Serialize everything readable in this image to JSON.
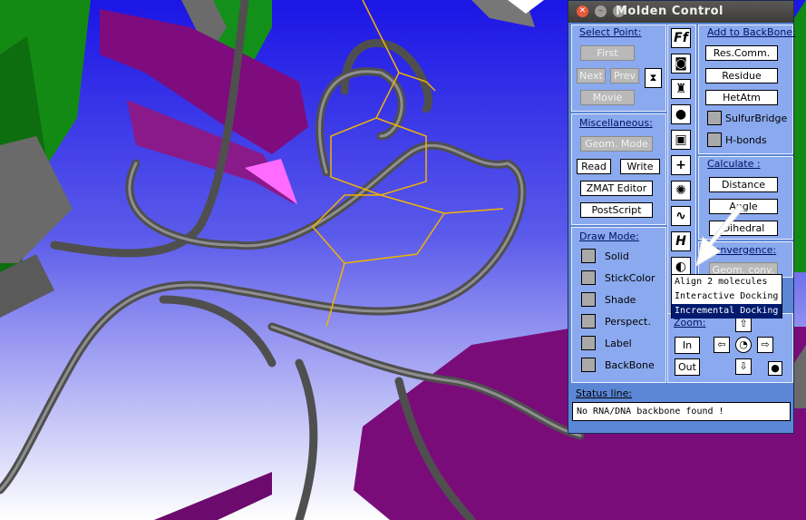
{
  "window": {
    "title": "Molden Control"
  },
  "select_point": {
    "title": "Select Point:",
    "first_label": "First",
    "next_label": "Next",
    "prev_label": "Prev",
    "movie_label": "Movie"
  },
  "miscellaneous": {
    "title": "Miscellaneous:",
    "geom_mode_label": "Geom. Mode",
    "read_label": "Read",
    "write_label": "Write",
    "zmat_label": "ZMAT Editor",
    "postscript_label": "PostScript"
  },
  "draw_mode": {
    "title": "Draw Mode:",
    "items": [
      {
        "label": "Solid",
        "checked": false
      },
      {
        "label": "StickColor",
        "checked": false
      },
      {
        "label": "Shade",
        "checked": false
      },
      {
        "label": "Perspect.",
        "checked": false
      },
      {
        "label": "Label",
        "checked": false
      },
      {
        "label": "BackBone",
        "checked": false
      }
    ]
  },
  "toolbar_icons": [
    "Ff",
    "camera-icon",
    "robot-icon",
    "apple-icon",
    "cube-icon",
    "axis-icon",
    "molecule-icon",
    "vibration-icon",
    "H",
    "dock-icon"
  ],
  "add_backbone": {
    "title": "Add to BackBone:",
    "res_comm_label": "Res.Comm.",
    "residue_label": "Residue",
    "hetatm_label": "HetAtm",
    "sulfurbridge_label": "SulfurBridge",
    "hbonds_label": "H-bonds"
  },
  "calculate": {
    "title": "Calculate :",
    "distance_label": "Distance",
    "angle_label": "Angle",
    "dihedral_label": "Dihedral"
  },
  "convergence": {
    "title": "Convergence:",
    "button_label": "Geom. conv."
  },
  "zoom": {
    "title": "Zoom:",
    "in_label": "In",
    "out_label": "Out"
  },
  "dock_menu": {
    "items": [
      "Align 2 molecules",
      "Interactive Docking",
      "Incremental Docking"
    ],
    "selected": "Incremental Docking"
  },
  "status": {
    "title": "Status line:",
    "text": "No RNA/DNA backbone found !"
  },
  "colors": {
    "accent": "#5b87d6",
    "panel": "#8aa9ee",
    "background_top": "#1f18e8",
    "background_bottom": "#ffffff"
  }
}
